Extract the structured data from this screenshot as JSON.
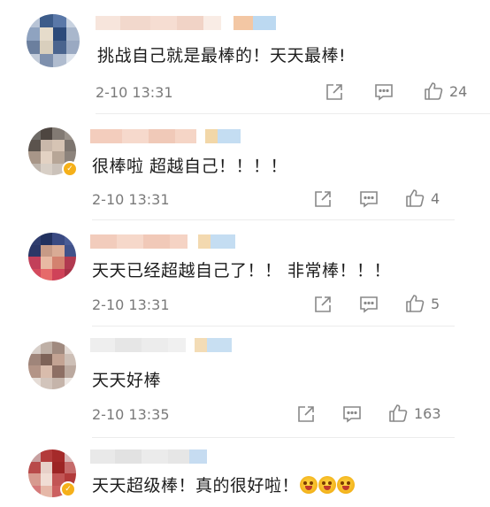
{
  "comments": [
    {
      "text": "挑战自己就是最棒的！天天最棒!",
      "time": "2-10 13:31",
      "likes": "24"
    },
    {
      "text": "很棒啦 超越自己！！！！",
      "time": "2-10 13:31",
      "likes": "4"
    },
    {
      "text": "天天已经超越自己了！！ 非常棒！！！",
      "time": "2-10 13:31",
      "likes": "5"
    },
    {
      "text": "天天好棒",
      "time": "2-10 13:35",
      "likes": "163"
    },
    {
      "text": "天天超级棒！真的很好啦！",
      "emojis": [
        "grinning-face-emoji",
        "grinning-face-emoji",
        "grinning-face-emoji"
      ]
    }
  ],
  "icons": {
    "share": "share-icon",
    "reply": "comment-icon",
    "like": "thumbs-up-icon"
  },
  "colors": {
    "text": "#1c1c1c",
    "meta": "#7a7a7a",
    "icon": "#888888",
    "vip_badge": "#f5b01a"
  }
}
